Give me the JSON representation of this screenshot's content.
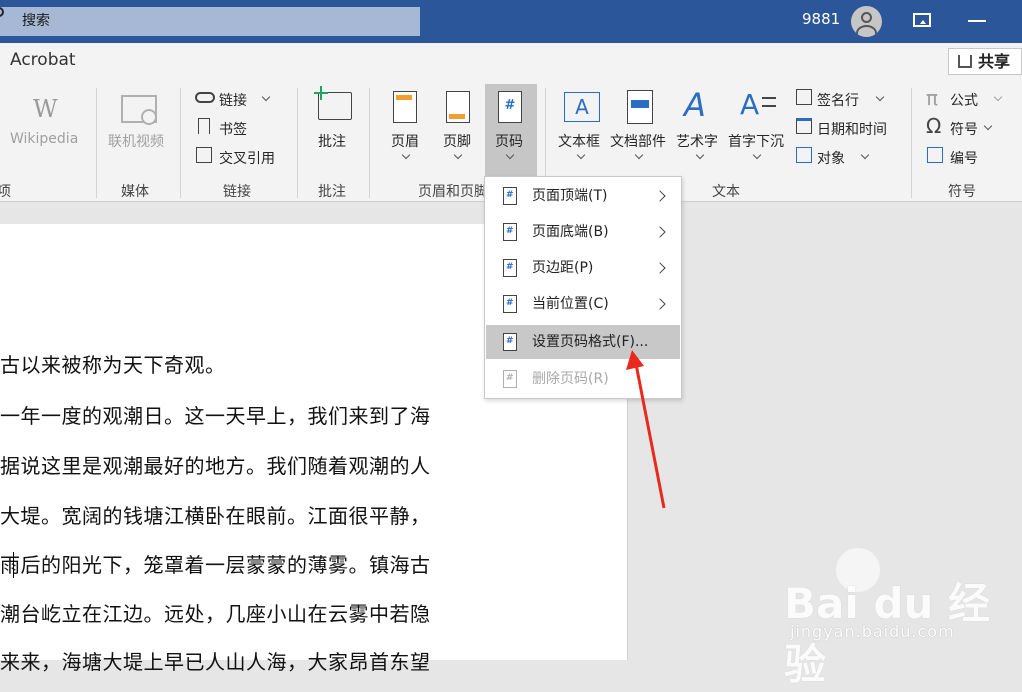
{
  "titlebar": {
    "search_placeholder": "搜索",
    "user_id": "9881"
  },
  "tabs": {
    "acrobat": "Acrobat",
    "share": "共享"
  },
  "ribbon": {
    "wikipedia": {
      "label": "Wikipedia"
    },
    "group_edge_label": "项",
    "media": {
      "online_video": "联机视频",
      "group": "媒体"
    },
    "links": {
      "link": "链接",
      "bookmark": "书签",
      "cross_ref": "交叉引用",
      "group": "链接"
    },
    "comments": {
      "comment": "批注",
      "group": "批注"
    },
    "header_footer": {
      "header": "页眉",
      "footer": "页脚",
      "page_number": "页码",
      "group": "页眉和页脚"
    },
    "text": {
      "textbox": "文本框",
      "quick_parts": "文档部件",
      "wordart": "艺术字",
      "dropcap": "首字下沉",
      "signature": "签名行",
      "datetime": "日期和时间",
      "object": "对象",
      "group": "文本"
    },
    "symbols": {
      "equation": "公式",
      "symbol": "符号",
      "number": "编号",
      "group": "符号"
    }
  },
  "menu": {
    "items": [
      {
        "label": "页面顶端(T)"
      },
      {
        "label": "页面底端(B)"
      },
      {
        "label": "页边距(P)"
      },
      {
        "label": "当前位置(C)"
      },
      {
        "label": "设置页码格式(F)..."
      },
      {
        "label": "删除页码(R)"
      }
    ]
  },
  "document": {
    "lines": [
      "古以来被称为天下奇观。",
      "一年一度的观潮日。这一天早上，我们来到了海",
      "据说这里是观潮最好的地方。我们随着观潮的人",
      "大堤。宽阔的钱塘江横卧在眼前。江面很平静，",
      "雨后的阳光下，笼罩着一层蒙蒙的薄雾。镇海古",
      "潮台屹立在江边。远处，几座小山在云雾中若隐",
      "来来，海塘大堤上早已人山人海，大家昂首东望"
    ]
  },
  "watermark": {
    "brand": "Bai du 经验",
    "url": "jingyan.baidu.com"
  },
  "colors": {
    "titlebar": "#2b579a",
    "ribbon": "#f3f3f3",
    "highlight": "#c8c8c8",
    "arrow": "#e8291c"
  }
}
